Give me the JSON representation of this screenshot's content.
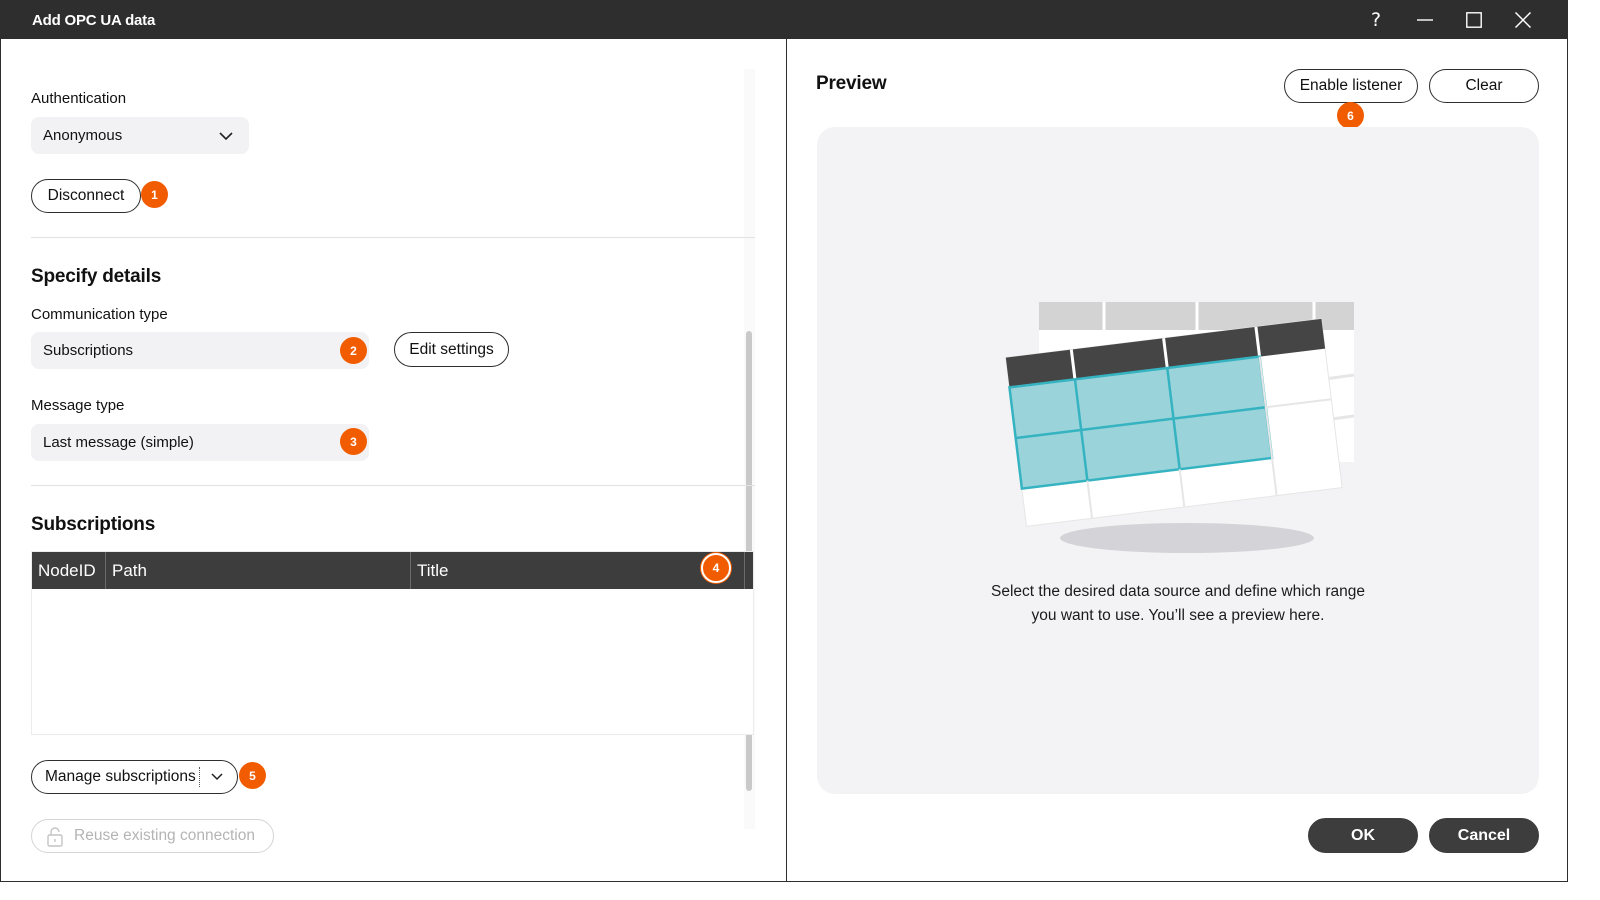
{
  "window": {
    "title": "Add OPC UA data",
    "controls": {
      "help": "?",
      "minimize": "minimize-icon",
      "maximize": "maximize-icon",
      "close": "close-icon"
    }
  },
  "left": {
    "authentication": {
      "label": "Authentication",
      "value": "Anonymous"
    },
    "disconnect_label": "Disconnect",
    "badges": [
      "1",
      "2",
      "3",
      "4",
      "5",
      "6"
    ],
    "specify_details": {
      "heading": "Specify details",
      "communication_type": {
        "label": "Communication type",
        "value": "Subscriptions"
      },
      "edit_settings_label": "Edit settings",
      "message_type": {
        "label": "Message type",
        "value": "Last message (simple)"
      }
    },
    "subscriptions": {
      "heading": "Subscriptions",
      "columns": [
        "NodeID",
        "Path",
        "Title"
      ],
      "rows": []
    },
    "manage_subscriptions_label": "Manage subscriptions",
    "reuse_connection_label": "Reuse existing connection"
  },
  "right": {
    "heading": "Preview",
    "enable_listener_label": "Enable listener",
    "clear_label": "Clear",
    "preview_text_line1": "Select the desired data source and define which range",
    "preview_text_line2": "you want to use. You’ll see a preview here.",
    "ok_label": "OK",
    "cancel_label": "Cancel"
  },
  "colors": {
    "titlebar": "#2e2e2e",
    "badge": "#f25c00",
    "table_header": "#3d3d3d",
    "preview_bg": "#f3f3f6",
    "illustration_teal": "#9ad3da"
  }
}
